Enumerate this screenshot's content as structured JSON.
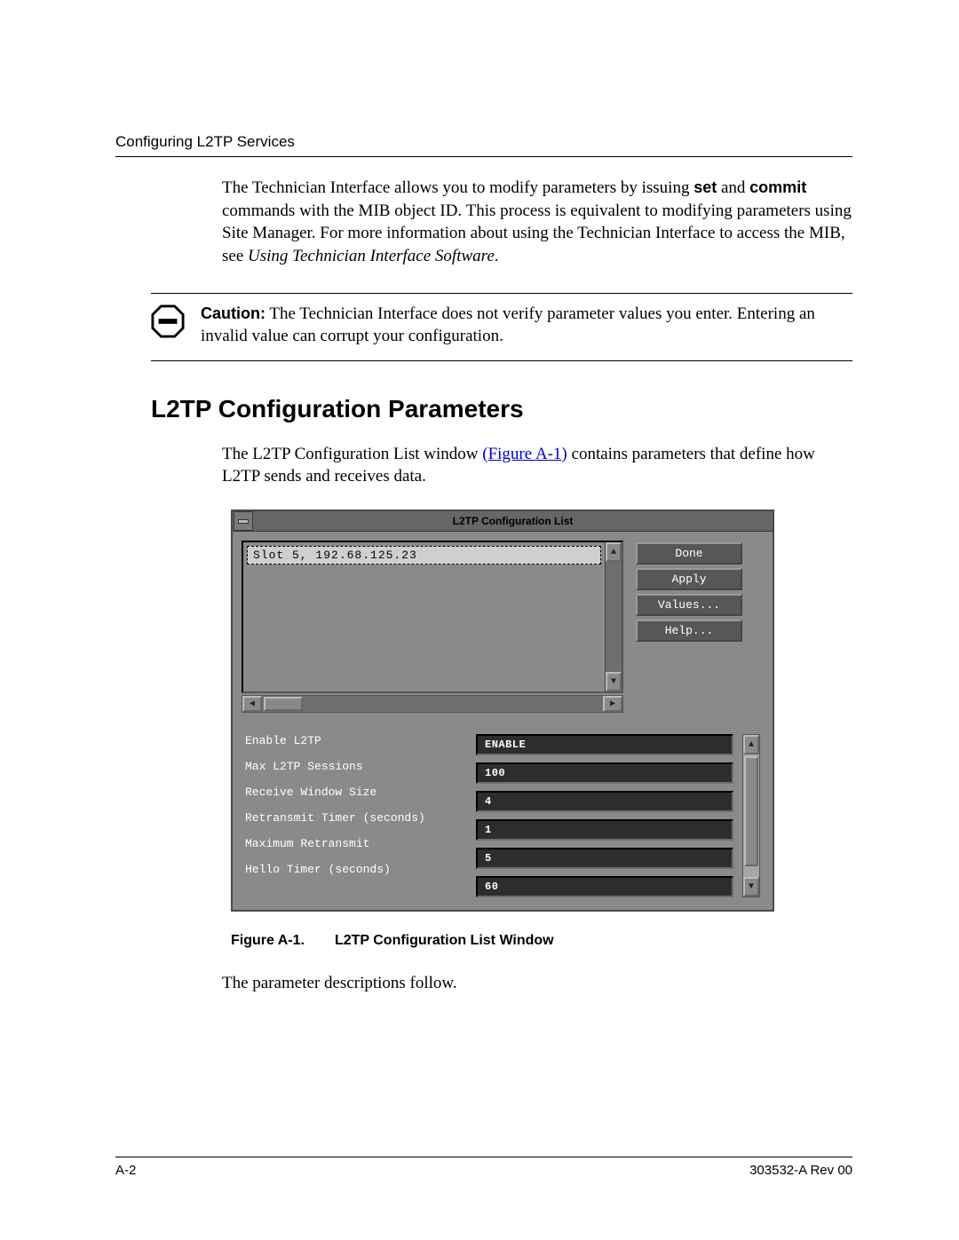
{
  "header": {
    "running_head": "Configuring L2TP Services"
  },
  "intro": {
    "p1_a": "The Technician Interface allows you to modify parameters by issuing ",
    "p1_set": "set",
    "p1_b": " and ",
    "p1_commit": "commit",
    "p1_c": " commands with the MIB object ID. This process is equivalent to modifying parameters using Site Manager. For more information about using the Technician Interface to access the MIB, see ",
    "p1_ital": "Using Technician Interface Software",
    "p1_d": "."
  },
  "caution": {
    "label": "Caution:",
    "text": " The Technician Interface does not verify parameter values you enter. Entering an invalid value can corrupt your configuration."
  },
  "section_title": "L2TP Configuration Parameters",
  "body": {
    "p_a": "The L2TP Configuration List window ",
    "link": "(Figure A-1)",
    "p_b": " contains parameters that define how L2TP sends and receives data."
  },
  "window": {
    "title": "L2TP Configuration List",
    "selected_row": "Slot 5, 192.68.125.23",
    "buttons": {
      "done": "Done",
      "apply": "Apply",
      "values": "Values...",
      "help": "Help..."
    },
    "params": [
      {
        "label": "Enable L2TP",
        "value": "ENABLE"
      },
      {
        "label": "Max L2TP Sessions",
        "value": "100"
      },
      {
        "label": "Receive Window Size",
        "value": "4"
      },
      {
        "label": "Retransmit Timer (seconds)",
        "value": "1"
      },
      {
        "label": "Maximum Retransmit",
        "value": "5"
      },
      {
        "label": "Hello Timer (seconds)",
        "value": "60"
      }
    ]
  },
  "figure": {
    "num": "Figure A-1.",
    "title": "L2TP Configuration List Window"
  },
  "follow": "The parameter descriptions follow.",
  "footer": {
    "page": "A-2",
    "doc": "303532-A Rev 00"
  }
}
